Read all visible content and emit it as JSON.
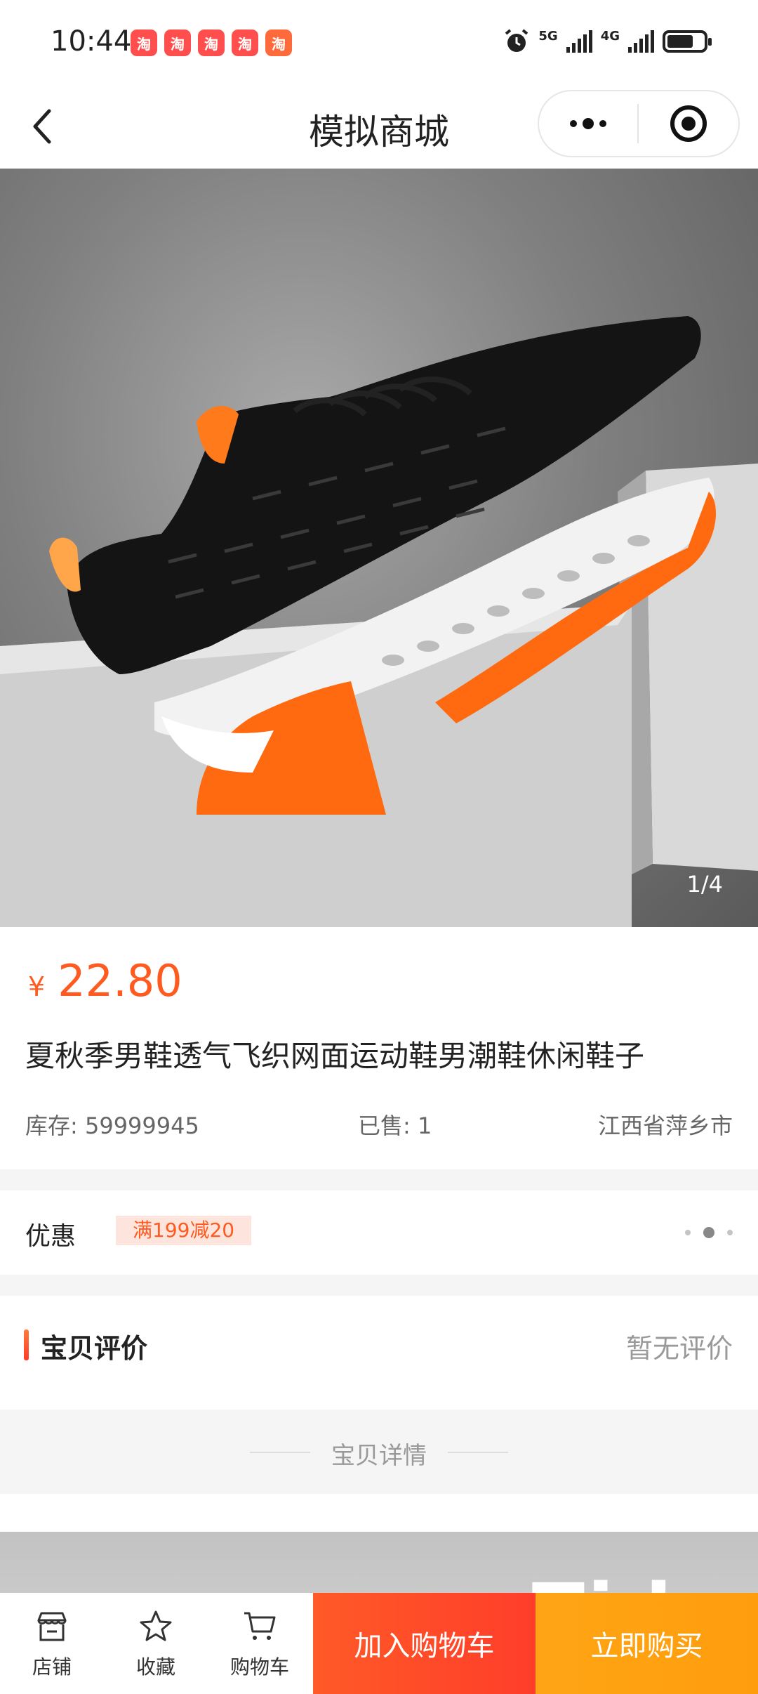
{
  "status_bar": {
    "time": "10:44",
    "notifications": [
      "淘",
      "淘",
      "淘",
      "淘",
      "淘"
    ],
    "signal_5g": "5G",
    "signal_4g": "4G",
    "battery_level": 0.7,
    "alarm_icon": "alarm-icon"
  },
  "nav": {
    "title": "模拟商城",
    "back_icon": "chevron-left-icon",
    "more_icon": "more-dots-icon",
    "close_icon": "target-close-icon"
  },
  "gallery": {
    "counter": "1/4"
  },
  "product": {
    "currency": "¥",
    "price": "22.80",
    "title": "夏秋季男鞋透气飞织网面运动鞋男潮鞋休闲鞋子",
    "stock_label": "库存:",
    "stock_value": "59999945",
    "sold_label": "已售:",
    "sold_value": "1",
    "location": "江西省萍乡市"
  },
  "promo": {
    "label": "优惠",
    "tag": "满199减20"
  },
  "reviews": {
    "title": "宝贝评价",
    "empty_text": "暂无评价"
  },
  "details": {
    "title": "宝贝详情"
  },
  "bottom_bar": {
    "tabs": [
      {
        "label": "店铺",
        "icon": "store-icon"
      },
      {
        "label": "收藏",
        "icon": "star-icon"
      },
      {
        "label": "购物车",
        "icon": "cart-icon"
      }
    ],
    "add_to_cart": "加入购物车",
    "buy_now": "立即购买"
  },
  "colors": {
    "accent": "#ff5a1f",
    "cart_button": "#ff4127",
    "buy_button": "#ffa314",
    "background_gray": "#f5f5f5"
  }
}
